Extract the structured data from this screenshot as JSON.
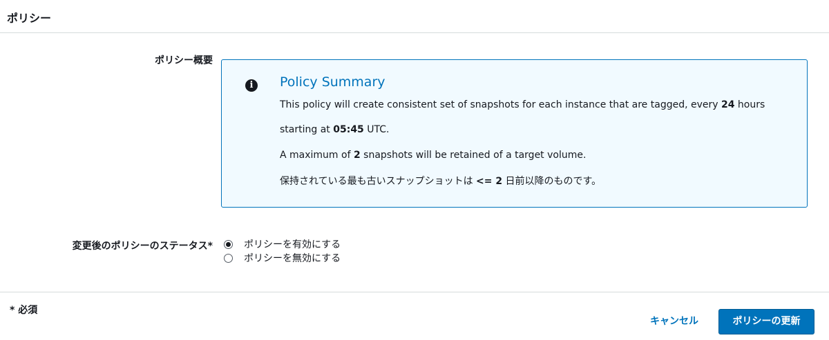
{
  "section": {
    "title": "ポリシー"
  },
  "summary_label": "ポリシー概要",
  "info": {
    "icon": "info-icon",
    "title": "Policy Summary",
    "line1_pre": "This policy will create consistent set of snapshots for each instance that are tagged, every ",
    "line1_value": "24",
    "line1_post": " hours",
    "line2_pre": "starting at ",
    "line2_value": "05:45",
    "line2_post": " UTC.",
    "line3_pre": "A maximum of ",
    "line3_value": "2",
    "line3_post": " snapshots will be retained of a target volume.",
    "line4_pre": "保持されている最も古いスナップショットは ",
    "line4_value": "<= 2",
    "line4_post": " 日前以降のものです。"
  },
  "status": {
    "label": "変更後のポリシーのステータス*",
    "options": [
      {
        "label": "ポリシーを有効にする",
        "checked": true
      },
      {
        "label": "ポリシーを無効にする",
        "checked": false
      }
    ]
  },
  "footer": {
    "required_note": "* 必須",
    "cancel_label": "キャンセル",
    "submit_label": "ポリシーの更新"
  },
  "colors": {
    "accent": "#0073bb",
    "info_bg": "#f1faff"
  }
}
